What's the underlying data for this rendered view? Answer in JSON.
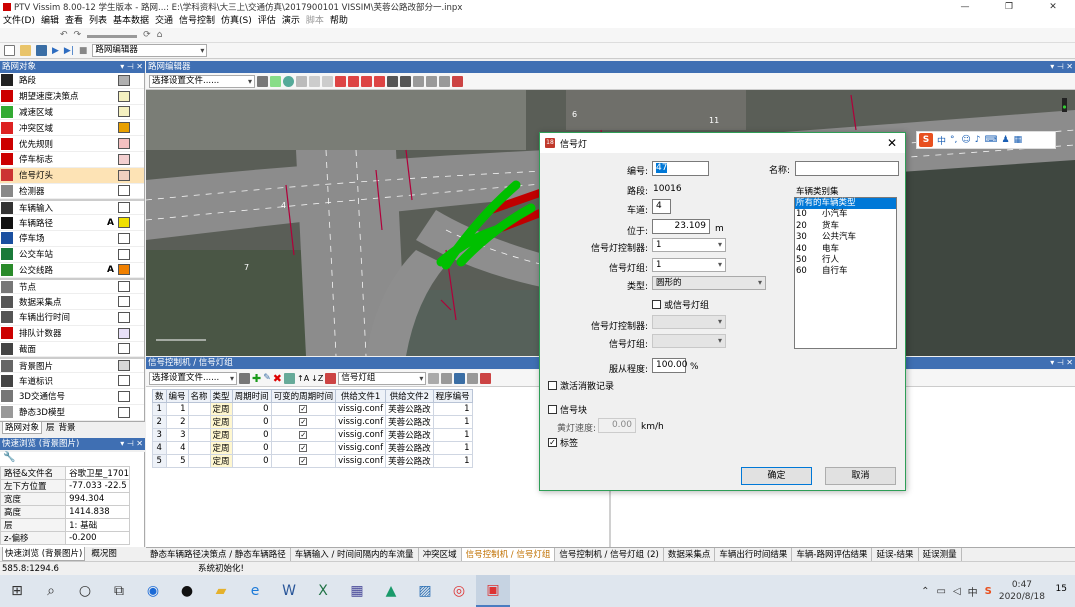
{
  "window": {
    "title": "PTV Vissim 8.00-12 学生版本 - 路网...: E:\\学科资料\\大三上\\交通仿真\\2017900101 VISSIM\\芙蓉公路改部分一.inpx",
    "minimize": "—",
    "maximize": "❐",
    "close": "✕"
  },
  "menu": [
    "文件(D)",
    "编辑",
    "查看",
    "列表",
    "基本数据",
    "交通",
    "信号控制",
    "仿真(S)",
    "评估",
    "演示",
    "脚本",
    "帮助"
  ],
  "toolbar": {
    "mode_combo": "路网编辑器"
  },
  "network_objects": {
    "header": "路网对象",
    "items": [
      {
        "label": "路段",
        "color": "#b0b0b0",
        "letter": ""
      },
      {
        "label": "期望速度决策点",
        "color": "#f4f0c0",
        "letter": ""
      },
      {
        "label": "减速区域",
        "color": "#f4f0c0",
        "letter": ""
      },
      {
        "label": "冲突区域",
        "color": "#e8a000",
        "letter": ""
      },
      {
        "label": "优先规则",
        "color": "#f4c0c0",
        "letter": ""
      },
      {
        "label": "停车标志",
        "color": "#f4d0d0",
        "letter": ""
      },
      {
        "label": "信号灯头",
        "color": "#f0d0c0",
        "letter": ""
      },
      {
        "label": "检测器",
        "color": "#ffffff",
        "letter": ""
      },
      {
        "label": "车辆输入",
        "color": "#ffffff",
        "letter": ""
      },
      {
        "label": "车辆路径",
        "color": "#f0e000",
        "letter": "A"
      },
      {
        "label": "停车场",
        "color": "#ffffff",
        "letter": ""
      },
      {
        "label": "公交车站",
        "color": "#ffffff",
        "letter": ""
      },
      {
        "label": "公交线路",
        "color": "#f08000",
        "letter": "A"
      },
      {
        "label": "节点",
        "color": "#ffffff",
        "letter": ""
      },
      {
        "label": "数据采集点",
        "color": "#ffffff",
        "letter": ""
      },
      {
        "label": "车辆出行时间",
        "color": "#ffffff",
        "letter": ""
      },
      {
        "label": "排队计数器",
        "color": "#e8e0f8",
        "letter": ""
      },
      {
        "label": "截面",
        "color": "#ffffff",
        "letter": ""
      },
      {
        "label": "背景图片",
        "color": "#d8d8d8",
        "letter": ""
      },
      {
        "label": "车道标识",
        "color": "#ffffff",
        "letter": ""
      },
      {
        "label": "3D交通信号",
        "color": "#ffffff",
        "letter": ""
      },
      {
        "label": "静态3D模型",
        "color": "#ffffff",
        "letter": ""
      }
    ],
    "tabs": [
      "路网对象",
      "层",
      "背景"
    ]
  },
  "quick_view": {
    "header": "快速浏览 (背景图片)",
    "rows": [
      {
        "k": "路径&文件名",
        "v": "谷歌卫星_1701"
      },
      {
        "k": "左下方位置",
        "v": "-77.033 -22.5"
      },
      {
        "k": "宽度",
        "v": "994.304"
      },
      {
        "k": "高度",
        "v": "1414.838"
      },
      {
        "k": "层",
        "v": "1: 基础"
      },
      {
        "k": "z-偏移",
        "v": "-0.200"
      }
    ],
    "tabs": [
      "快速浏览 (背景图片)",
      "概况图"
    ]
  },
  "map_editor": {
    "header": "路网编辑器",
    "preset_combo": "选择设置文件......",
    "labels": [
      "4",
      "6",
      "7",
      "11",
      "5"
    ]
  },
  "signal_panel": {
    "header": "信号控制机 / 信号灯组",
    "preset_combo": "选择设置文件......",
    "group_combo": "信号灯组",
    "columns": [
      "数",
      "编号",
      "名称",
      "类型",
      "周期时间",
      "可变的周期时间",
      "供给文件1",
      "供给文件2",
      "程序编号"
    ],
    "rows": [
      {
        "n": "1",
        "id": "1",
        "name": "",
        "type": "定周",
        "cycle": "0",
        "file1": "vissig.conf",
        "file2": "芙蓉公路改",
        "prog": "1"
      },
      {
        "n": "2",
        "id": "2",
        "name": "",
        "type": "定周",
        "cycle": "0",
        "file1": "vissig.conf",
        "file2": "芙蓉公路改",
        "prog": "1"
      },
      {
        "n": "3",
        "id": "3",
        "name": "",
        "type": "定周",
        "cycle": "0",
        "file1": "vissig.conf",
        "file2": "芙蓉公路改",
        "prog": "1"
      },
      {
        "n": "4",
        "id": "4",
        "name": "",
        "type": "定周",
        "cycle": "0",
        "file1": "vissig.conf",
        "file2": "芙蓉公路改",
        "prog": "1"
      },
      {
        "n": "5",
        "id": "5",
        "name": "",
        "type": "定周",
        "cycle": "0",
        "file1": "vissig.conf",
        "file2": "芙蓉公路改",
        "prog": "1"
      }
    ]
  },
  "bottom_tabs": [
    "静态车辆路径决策点 / 静态车辆路径",
    "车辆输入 / 时间间隔内的车流量",
    "冲突区域",
    "信号控制机 / 信号灯组",
    "信号控制机 / 信号灯组 (2)",
    "数据采集点",
    "车辆出行时间结果",
    "车辆-路网评估结果",
    "延误-结果",
    "延误测量"
  ],
  "status": {
    "coord": "585.8:1294.6",
    "message": "系统初始化!"
  },
  "dialog": {
    "title": "信号灯",
    "id_label": "编号:",
    "id_value": "47",
    "name_label": "名称:",
    "name_value": "",
    "link_label": "路段:",
    "link_value": "10016",
    "lane_label": "车道:",
    "lane_value": "4",
    "pos_label": "位于:",
    "pos_value": "23.109",
    "pos_unit": "m",
    "sc_label": "信号灯控制器:",
    "sc_value": "1",
    "sg_label": "信号灯组:",
    "sg_value": "1",
    "type_label": "类型:",
    "type_value": "圆形的",
    "or_group": "或信号灯组",
    "sc2_label": "信号灯控制器:",
    "sg2_label": "信号灯组:",
    "compliance_label": "服从程度:",
    "compliance_value": "100.00",
    "compliance_unit": "%",
    "activate_log": "激活消散记录",
    "signal_block": "信号块",
    "amber_speed_label": "黄灯速度:",
    "amber_speed_value": "0.00",
    "amber_speed_unit": "km/h",
    "label_check": "标签",
    "vclass_label": "车辆类别集",
    "vclasses": [
      {
        "code": "",
        "name": "所有的车辆类型"
      },
      {
        "code": "10",
        "name": "小汽车"
      },
      {
        "code": "20",
        "name": "货车"
      },
      {
        "code": "30",
        "name": "公共汽车"
      },
      {
        "code": "40",
        "name": "电车"
      },
      {
        "code": "50",
        "name": "行人"
      },
      {
        "code": "60",
        "name": "自行车"
      }
    ],
    "ok": "确定",
    "cancel": "取消"
  },
  "ime": {
    "mode": "中"
  },
  "taskbar": {
    "time": "0:47",
    "date": "2020/8/18",
    "lang": "中",
    "notify": "15"
  }
}
